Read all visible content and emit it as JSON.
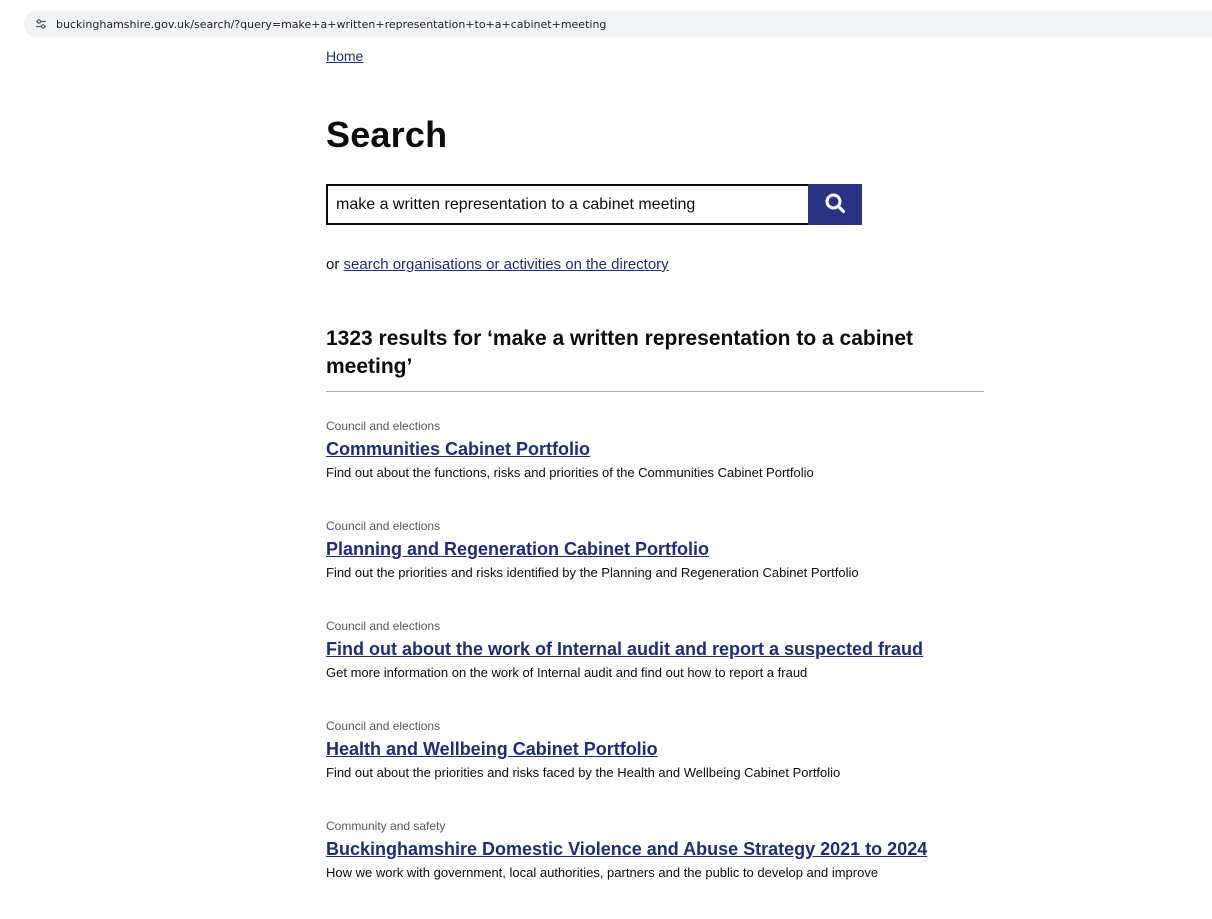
{
  "browser": {
    "url": "buckinghamshire.gov.uk/search/?query=make+a+written+representation+to+a+cabinet+meeting",
    "site_info_icon": "tune-icon"
  },
  "breadcrumb": {
    "home_label": "Home"
  },
  "page": {
    "title": "Search"
  },
  "search": {
    "query": "make a written representation to a cabinet meeting",
    "button_icon": "search-icon",
    "button_color": "#2b3384"
  },
  "directory": {
    "prefix": "or ",
    "link_label": "search organisations or activities on the directory"
  },
  "results_heading": "1323 results for ‘make a written representation to a cabinet meeting’",
  "results": [
    {
      "category": "Council and elections",
      "title": "Communities Cabinet Portfolio",
      "description": "Find out about the functions, risks and priorities of the Communities Cabinet Portfolio"
    },
    {
      "category": "Council and elections",
      "title": "Planning and Regeneration Cabinet Portfolio",
      "description": "Find out the priorities and risks identified by the Planning and Regeneration Cabinet Portfolio"
    },
    {
      "category": "Council and elections",
      "title": "Find out about the work of Internal audit and report a suspected fraud",
      "description": "Get more information on the work of Internal audit and find out how to report a fraud"
    },
    {
      "category": "Council and elections",
      "title": "Health and Wellbeing Cabinet Portfolio",
      "description": "Find out about the priorities and risks faced by the Health and Wellbeing Cabinet Portfolio"
    },
    {
      "category": "Community and safety",
      "title": "Buckinghamshire Domestic Violence and Abuse Strategy 2021 to 2024",
      "description": "How we work with government, local authorities, partners and the public to develop and improve"
    }
  ],
  "colors": {
    "link": "#1d2c7e",
    "text": "#0b0c0c",
    "muted": "#505a5f",
    "rule": "#b1b4b6"
  }
}
